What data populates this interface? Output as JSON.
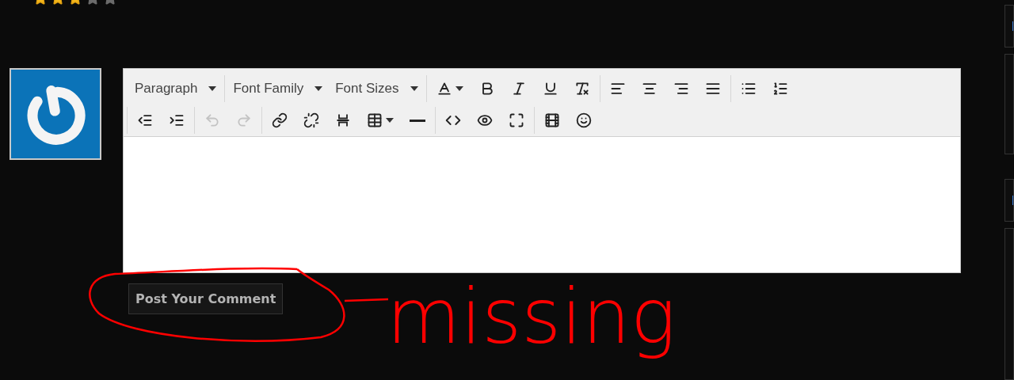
{
  "rating": {
    "stars": 3
  },
  "editor": {
    "toolbar_rows": [
      {
        "groups": [
          {
            "items": [
              {
                "kind": "dropdown",
                "label": "Paragraph"
              }
            ]
          },
          {
            "items": [
              {
                "kind": "dropdown",
                "label": "Font Family"
              },
              {
                "kind": "dropdown",
                "label": "Font Sizes"
              }
            ]
          },
          {
            "items": [
              {
                "kind": "button",
                "disabled": false
              },
              {
                "kind": "button",
                "disabled": false
              },
              {
                "kind": "button",
                "disabled": false
              },
              {
                "kind": "button",
                "disabled": false
              },
              {
                "kind": "button",
                "disabled": false
              }
            ]
          },
          {
            "items": [
              {
                "kind": "button",
                "disabled": false
              },
              {
                "kind": "button",
                "disabled": false
              },
              {
                "kind": "button",
                "disabled": false
              },
              {
                "kind": "button",
                "disabled": false
              }
            ]
          },
          {
            "items": [
              {
                "kind": "button",
                "disabled": false
              },
              {
                "kind": "button",
                "disabled": false
              }
            ]
          }
        ]
      },
      {
        "groups": [
          {
            "items": [
              {
                "kind": "button",
                "disabled": false
              },
              {
                "kind": "button",
                "disabled": false
              }
            ]
          },
          {
            "items": [
              {
                "kind": "button",
                "disabled": true
              },
              {
                "kind": "button",
                "disabled": true
              }
            ]
          },
          {
            "items": [
              {
                "kind": "button",
                "disabled": false
              },
              {
                "kind": "button",
                "disabled": false
              },
              {
                "kind": "button",
                "disabled": false
              },
              {
                "kind": "button",
                "disabled": false
              },
              {
                "kind": "button",
                "disabled": false
              }
            ]
          },
          {
            "items": [
              {
                "kind": "button",
                "disabled": false
              },
              {
                "kind": "button",
                "disabled": false
              },
              {
                "kind": "button",
                "disabled": false
              }
            ]
          },
          {
            "items": [
              {
                "kind": "button",
                "disabled": false
              },
              {
                "kind": "button",
                "disabled": false
              }
            ]
          }
        ]
      }
    ]
  },
  "submit_button": "Post Your Comment",
  "annotation": "missing"
}
